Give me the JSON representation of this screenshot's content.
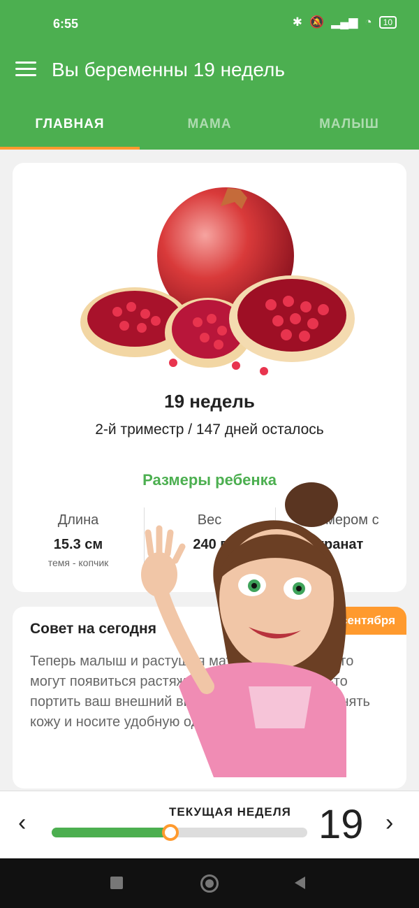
{
  "status_bar": {
    "time": "6:55",
    "battery": "10"
  },
  "app_bar": {
    "title": "Вы беременны 19 недель"
  },
  "tabs": [
    {
      "label": "ГЛАВНАЯ",
      "active": true
    },
    {
      "label": "МАМА",
      "active": false
    },
    {
      "label": "МАЛЫШ",
      "active": false
    }
  ],
  "main_card": {
    "fruit_icon": "pomegranate",
    "week_title": "19 недель",
    "trimester_text": "2-й триместр / 147 дней осталось",
    "sizes_title": "Размеры ребенка",
    "metrics": [
      {
        "label": "Длина",
        "value": "15.3 см",
        "sub": "темя - копчик"
      },
      {
        "label": "Вес",
        "value": "240 г",
        "sub": ""
      },
      {
        "label": "Размером с",
        "value": "гранат",
        "sub": ""
      }
    ]
  },
  "tip_card": {
    "title": "Совет на сегодня",
    "date_badge": "сентября",
    "text": "Теперь малыш и растущая матка в животике. Это могут появиться растяжки, которые будут чем-то портить ваш внешний вид. Не забывайте увлажнять кожу и носите удобную одежду."
  },
  "week_bar": {
    "label": "ТЕКУЩАЯ НЕДЕЛЯ",
    "number": "19",
    "progress": 0.465
  },
  "colors": {
    "primary": "#4caf50",
    "accent": "#ff9a2e"
  },
  "icons": {
    "menu": "hamburger-icon",
    "prev": "chevron-left-icon",
    "next": "chevron-right-icon"
  }
}
